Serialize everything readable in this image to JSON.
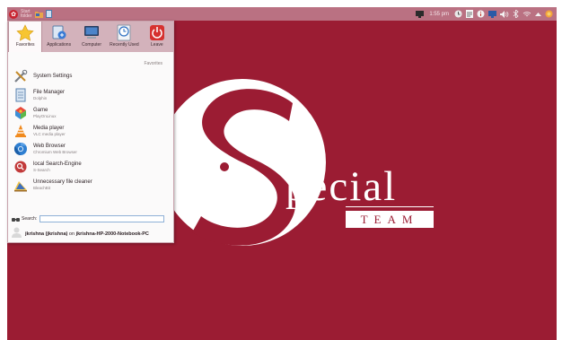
{
  "colors": {
    "wallpaper": "#9b1c33",
    "panel": "#ba7182",
    "menu_background": "#fbfafa",
    "tabbar": "#d3b2bb"
  },
  "panel": {
    "launcher_icon": "kde-launcher-icon",
    "left_icons": [
      "folder-icon",
      "file-icon"
    ],
    "task_label": "Start\nfolder",
    "clock": "1:55 pm",
    "tray_icons": [
      "monitor-icon",
      "clock-icon",
      "notes-icon",
      "info-icon",
      "network-icon",
      "volume-icon",
      "bluetooth-icon",
      "wifi-icon",
      "arrow-up-icon",
      "power-icon"
    ]
  },
  "menu": {
    "tabs": [
      {
        "label": "Favorites",
        "icon": "star-icon",
        "active": true
      },
      {
        "label": "Applications",
        "icon": "applications-icon",
        "active": false
      },
      {
        "label": "Computer",
        "icon": "computer-icon",
        "active": false
      },
      {
        "label": "Recently Used",
        "icon": "clock-icon",
        "active": false
      },
      {
        "label": "Leave",
        "icon": "power-icon",
        "active": false
      }
    ],
    "section_title": "Favorites",
    "items": [
      {
        "title": "System Settings",
        "subtitle": "",
        "icon": "settings-tools-icon"
      },
      {
        "title": "File Manager",
        "subtitle": "Dolphin",
        "icon": "file-manager-icon"
      },
      {
        "title": "Game",
        "subtitle": "PlayOnLinux",
        "icon": "playonlinux-icon"
      },
      {
        "title": "Media player",
        "subtitle": "VLC media player",
        "icon": "vlc-cone-icon"
      },
      {
        "title": "Web Browser",
        "subtitle": "Chromium Web Browser",
        "icon": "chromium-icon"
      },
      {
        "title": "local Search-Engine",
        "subtitle": "S-Search",
        "icon": "search-engine-icon"
      },
      {
        "title": "Unnecessary file cleaner",
        "subtitle": "BleachBit",
        "icon": "bleachbit-icon"
      }
    ],
    "search": {
      "label": "Search:",
      "value": "",
      "placeholder": ""
    },
    "user": {
      "name": "jkrishna (jkrishna)",
      "connector": " on ",
      "host": "jkrishna-HP-2000-Notebook-PC"
    }
  },
  "wallpaper": {
    "word": "pecial",
    "sub": "TEAM"
  }
}
